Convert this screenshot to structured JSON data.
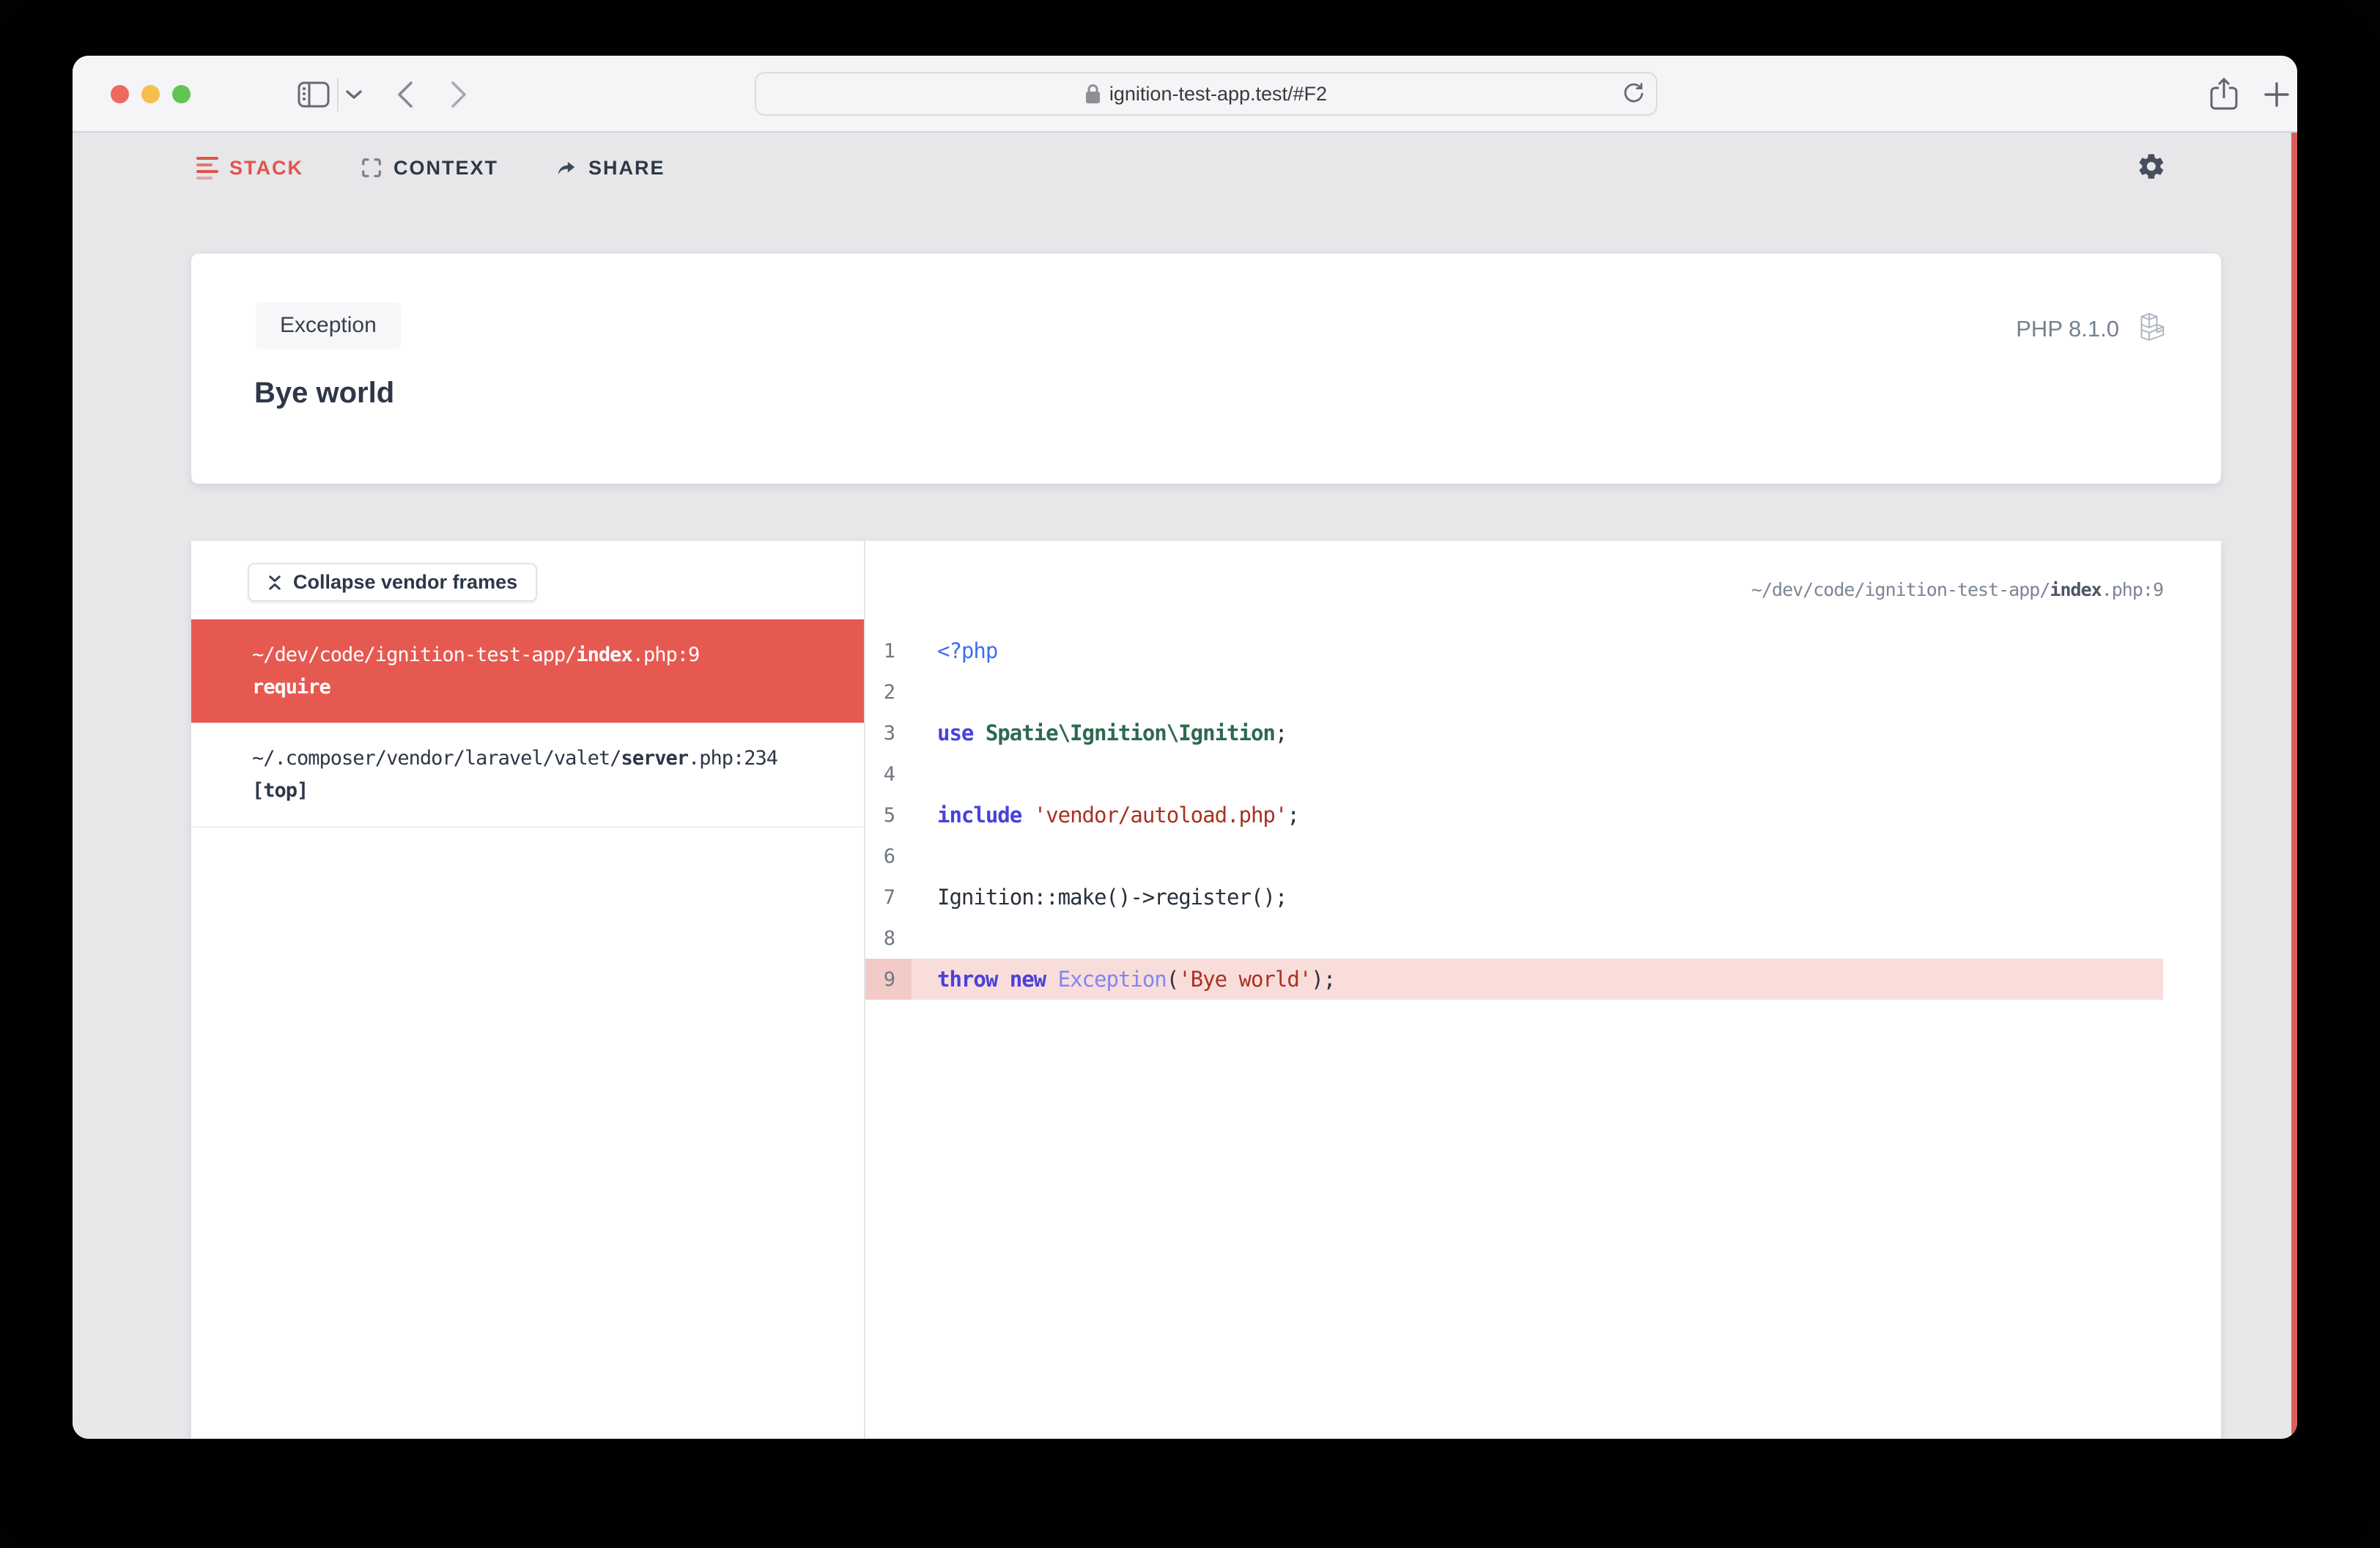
{
  "browser": {
    "url": "ignition-test-app.test/#F2"
  },
  "nav": {
    "tabs": [
      {
        "label": "STACK",
        "active": true
      },
      {
        "label": "CONTEXT",
        "active": false
      },
      {
        "label": "SHARE",
        "active": false
      }
    ]
  },
  "exception_card": {
    "badge": "Exception",
    "message": "Bye world",
    "php_version": "PHP 8.1.0"
  },
  "stack_panel": {
    "collapse_button": "Collapse vendor frames",
    "frames": [
      {
        "path_prefix": "~/dev/code/ignition-test-app/",
        "file": "index",
        "suffix": ".php:9",
        "method": "require",
        "active": true
      },
      {
        "path_prefix": "~/.composer/vendor/laravel/valet/",
        "file": "server",
        "suffix": ".php:234",
        "method": "[top]",
        "active": false
      }
    ]
  },
  "code_panel": {
    "header": {
      "prefix": "~/dev/code/ignition-test-app/",
      "file": "index",
      "suffix": ".php:9"
    },
    "lines": [
      {
        "n": 1,
        "segments": [
          {
            "t": "<?php",
            "c": "phptag"
          }
        ]
      },
      {
        "n": 2,
        "segments": []
      },
      {
        "n": 3,
        "segments": [
          {
            "t": "use ",
            "c": "kw"
          },
          {
            "t": "Spatie\\Ignition\\Ignition",
            "c": "cls"
          },
          {
            "t": ";",
            "c": "plain"
          }
        ]
      },
      {
        "n": 4,
        "segments": []
      },
      {
        "n": 5,
        "segments": [
          {
            "t": "include ",
            "c": "kw"
          },
          {
            "t": "'vendor/autoload.php'",
            "c": "str"
          },
          {
            "t": ";",
            "c": "plain"
          }
        ]
      },
      {
        "n": 6,
        "segments": []
      },
      {
        "n": 7,
        "segments": [
          {
            "t": "Ignition::make()->register();",
            "c": "plain"
          }
        ]
      },
      {
        "n": 8,
        "segments": []
      },
      {
        "n": 9,
        "highlight": true,
        "segments": [
          {
            "t": "throw new ",
            "c": "kw"
          },
          {
            "t": "Exception",
            "c": "exc"
          },
          {
            "t": "(",
            "c": "plain"
          },
          {
            "t": "'Bye world'",
            "c": "str"
          },
          {
            "t": ");",
            "c": "plain"
          }
        ]
      }
    ]
  },
  "colors": {
    "accent_red": "#E65951",
    "nav_red": "#E2534C",
    "highlight_row": "#F9DDDB",
    "highlight_gutter": "#F2CBC8",
    "page_bg": "#E7E7EA",
    "text_dark": "#2D3748"
  }
}
